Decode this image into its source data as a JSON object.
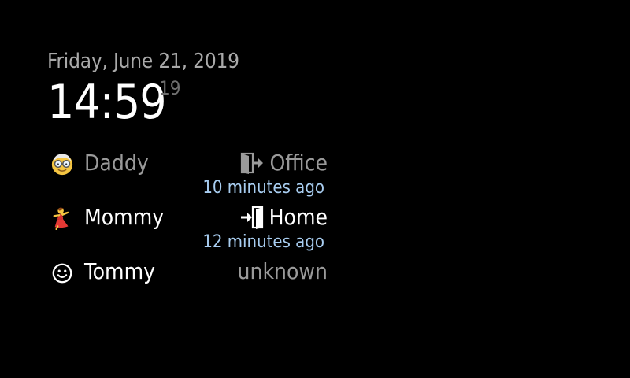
{
  "clock": {
    "date": "Friday, June 21, 2019",
    "time": "14:59",
    "seconds": "19"
  },
  "colors": {
    "background": "#000000",
    "date_text": "#a9a9a9",
    "time_text": "#ffffff",
    "seconds_text": "#6f6f6f",
    "away_text": "#9a9a9a",
    "home_text": "#ffffff",
    "ago_text": "#a8cdf0"
  },
  "members": [
    {
      "name": "Daddy",
      "icon": "old-man-face-icon",
      "status": "Office",
      "status_icon": "door-exit-icon",
      "ago": "10 minutes ago",
      "present": false
    },
    {
      "name": "Mommy",
      "icon": "dancer-icon",
      "status": "Home",
      "status_icon": "door-enter-icon",
      "ago": "12 minutes ago",
      "present": true
    },
    {
      "name": "Tommy",
      "icon": "smiley-face-icon",
      "status": "unknown",
      "status_icon": "",
      "ago": "",
      "present": true
    }
  ]
}
